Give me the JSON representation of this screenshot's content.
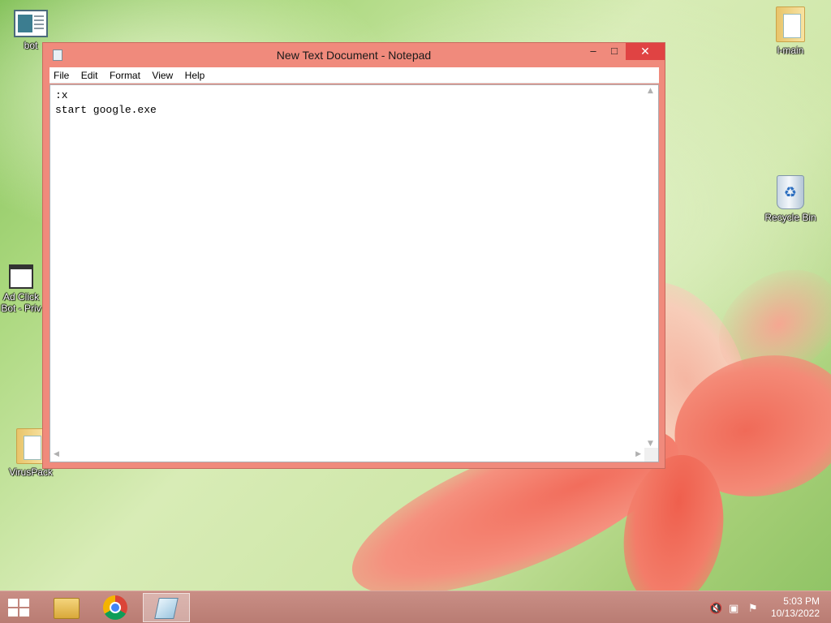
{
  "desktop": {
    "icons": [
      {
        "label": "bot"
      },
      {
        "label": "Ad Click Bot - Priv"
      },
      {
        "label": "VirusPack"
      },
      {
        "label": "l-main"
      },
      {
        "label": "Recycle Bin"
      }
    ]
  },
  "window": {
    "title": "New Text Document - Notepad",
    "minimize": "–",
    "maximize": "□",
    "close": "✕",
    "menu": [
      "File",
      "Edit",
      "Format",
      "View",
      "Help"
    ],
    "content": ":x\nstart google.exe"
  },
  "taskbar": {
    "apps": [
      "file-explorer",
      "chrome",
      "notepad"
    ],
    "clock_time": "5:03 PM",
    "clock_date": "10/13/2022"
  }
}
